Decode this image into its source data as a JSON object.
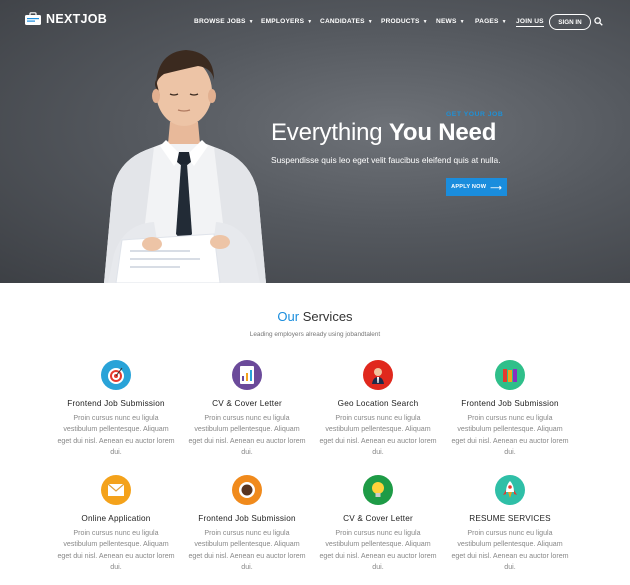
{
  "brand": {
    "name": "NEXTJOB"
  },
  "nav": {
    "items": [
      {
        "label": "BROWSE JOBS",
        "caret": true
      },
      {
        "label": "EMPLOYERS",
        "caret": true
      },
      {
        "label": "CANDIDATES",
        "caret": true
      },
      {
        "label": "PRODUCTS",
        "caret": true
      },
      {
        "label": "NEWS",
        "caret": true
      },
      {
        "label": "PAGES",
        "caret": true
      },
      {
        "label": "JOIN US",
        "caret": false
      }
    ],
    "signin_label": "SIGN IN",
    "search_icon": "search-icon"
  },
  "hero": {
    "eyebrow": "GET YOUR JOB",
    "title_light": "Everything ",
    "title_bold": "You Need",
    "subtitle": "Suspendisse quis leo eget velit faucibus eleifend quis at nulla.",
    "button_label": "APPLY NOW",
    "background": "#55595f"
  },
  "services": {
    "title_accent": "Our",
    "title_rest": " Services",
    "subtitle": "Leading employers already using jobandtalent",
    "accent_color": "#1a8ddd",
    "items": [
      {
        "title": "Frontend Job Submission",
        "desc": "Proin cursus nunc eu ligula vestibulum pellentesque. Aliquam eget dui nisl. Aenean eu auctor lorem dui.",
        "icon": "target-icon",
        "color": "#29a3d8"
      },
      {
        "title": "CV & Cover Letter",
        "desc": "Proin cursus nunc eu ligula vestibulum pellentesque. Aliquam eget dui nisl. Aenean eu auctor lorem dui.",
        "icon": "document-chart-icon",
        "color": "#6b4a9a"
      },
      {
        "title": "Geo Location Search",
        "desc": "Proin cursus nunc eu ligula vestibulum pellentesque. Aliquam eget dui nisl. Aenean eu auctor lorem dui.",
        "icon": "businessman-icon",
        "color": "#e0281d"
      },
      {
        "title": "Frontend Job Submission",
        "desc": "Proin cursus nunc eu ligula vestibulum pellentesque. Aliquam eget dui nisl. Aenean eu auctor lorem dui.",
        "icon": "folders-icon",
        "color": "#2fbf8a"
      },
      {
        "title": "Online Application",
        "desc": "Proin cursus nunc eu ligula vestibulum pellentesque. Aliquam eget dui nisl. Aenean eu auctor lorem dui.",
        "icon": "envelope-icon",
        "color": "#f4a21b"
      },
      {
        "title": "Frontend Job Submission",
        "desc": "Proin cursus nunc eu ligula vestibulum pellentesque. Aliquam eget dui nisl. Aenean eu auctor lorem dui.",
        "icon": "coffee-cup-icon",
        "color": "#f08a1c"
      },
      {
        "title": "CV & Cover Letter",
        "desc": "Proin cursus nunc eu ligula vestibulum pellentesque. Aliquam eget dui nisl. Aenean eu auctor lorem dui.",
        "icon": "lightbulb-icon",
        "color": "#1e9b46"
      },
      {
        "title": "RESUME SERVICES",
        "desc": "Proin cursus nunc eu ligula vestibulum pellentesque. Aliquam eget dui nisl. Aenean eu auctor lorem dui.",
        "icon": "rocket-icon",
        "color": "#2fbfa7"
      }
    ]
  }
}
